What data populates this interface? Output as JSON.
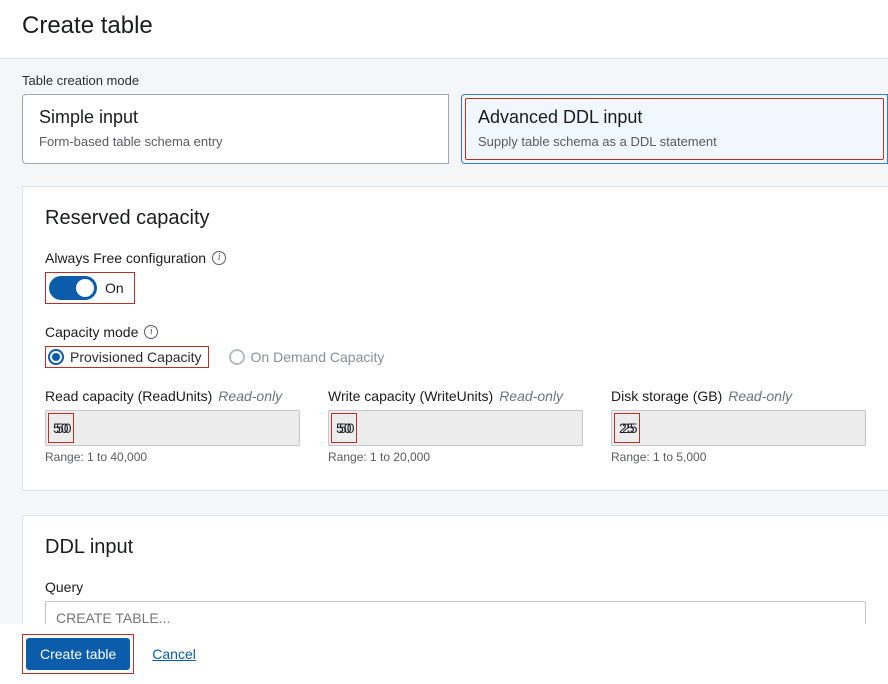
{
  "page": {
    "title": "Create table"
  },
  "mode": {
    "label": "Table creation mode",
    "simple": {
      "title": "Simple input",
      "sub": "Form-based table schema entry"
    },
    "advanced": {
      "title": "Advanced DDL input",
      "sub": "Supply table schema as a DDL statement"
    }
  },
  "reserved": {
    "title": "Reserved capacity",
    "always_free_label": "Always Free configuration",
    "toggle_state": "On",
    "capacity_mode_label": "Capacity mode",
    "provisioned_label": "Provisioned Capacity",
    "ondemand_label": "On Demand Capacity",
    "read": {
      "label": "Read capacity (ReadUnits)",
      "readonly": "Read-only",
      "value": "50",
      "help": "Range: 1 to 40,000"
    },
    "write": {
      "label": "Write capacity (WriteUnits)",
      "readonly": "Read-only",
      "value": "50",
      "help": "Range: 1 to 20,000"
    },
    "disk": {
      "label": "Disk storage (GB)",
      "readonly": "Read-only",
      "value": "25",
      "help": "Range: 1 to 5,000"
    }
  },
  "ddl": {
    "title": "DDL input",
    "query_label": "Query",
    "placeholder": "CREATE TABLE..."
  },
  "footer": {
    "create": "Create table",
    "cancel": "Cancel"
  }
}
